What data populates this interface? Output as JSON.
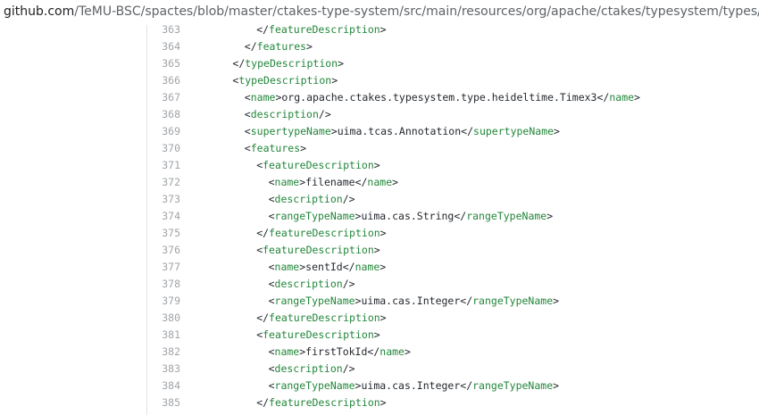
{
  "browser": {
    "url_domain": "github.com",
    "url_path": "/TeMU-BSC/spactes/blob/master/ctakes-type-system/src/main/resources/org/apache/ctakes/typesystem/types/TypeSystem.xml"
  },
  "colors": {
    "tag": "#22863a",
    "text": "#24292e",
    "line_number": "#a0a4a8",
    "gutter_border": "#e1e4e8"
  },
  "lines": [
    {
      "num": "363",
      "indent": 3,
      "parts": [
        {
          "t": "</",
          "c": "punct"
        },
        {
          "t": "featureDescription",
          "c": "tag"
        },
        {
          "t": ">",
          "c": "punct"
        }
      ]
    },
    {
      "num": "364",
      "indent": 2,
      "parts": [
        {
          "t": "</",
          "c": "punct"
        },
        {
          "t": "features",
          "c": "tag"
        },
        {
          "t": ">",
          "c": "punct"
        }
      ]
    },
    {
      "num": "365",
      "indent": 1,
      "parts": [
        {
          "t": "</",
          "c": "punct"
        },
        {
          "t": "typeDescription",
          "c": "tag"
        },
        {
          "t": ">",
          "c": "punct"
        }
      ]
    },
    {
      "num": "366",
      "indent": 1,
      "parts": [
        {
          "t": "<",
          "c": "punct"
        },
        {
          "t": "typeDescription",
          "c": "tag"
        },
        {
          "t": ">",
          "c": "punct"
        }
      ]
    },
    {
      "num": "367",
      "indent": 2,
      "parts": [
        {
          "t": "<",
          "c": "punct"
        },
        {
          "t": "name",
          "c": "tag"
        },
        {
          "t": ">",
          "c": "punct"
        },
        {
          "t": "org.apache.ctakes.typesystem.type.heideltime.Timex3",
          "c": "text"
        },
        {
          "t": "</",
          "c": "punct"
        },
        {
          "t": "name",
          "c": "tag"
        },
        {
          "t": ">",
          "c": "punct"
        }
      ]
    },
    {
      "num": "368",
      "indent": 2,
      "parts": [
        {
          "t": "<",
          "c": "punct"
        },
        {
          "t": "description",
          "c": "tag"
        },
        {
          "t": "/>",
          "c": "punct"
        }
      ]
    },
    {
      "num": "369",
      "indent": 2,
      "parts": [
        {
          "t": "<",
          "c": "punct"
        },
        {
          "t": "supertypeName",
          "c": "tag"
        },
        {
          "t": ">",
          "c": "punct"
        },
        {
          "t": "uima.tcas.Annotation",
          "c": "text"
        },
        {
          "t": "</",
          "c": "punct"
        },
        {
          "t": "supertypeName",
          "c": "tag"
        },
        {
          "t": ">",
          "c": "punct"
        }
      ]
    },
    {
      "num": "370",
      "indent": 2,
      "parts": [
        {
          "t": "<",
          "c": "punct"
        },
        {
          "t": "features",
          "c": "tag"
        },
        {
          "t": ">",
          "c": "punct"
        }
      ]
    },
    {
      "num": "371",
      "indent": 3,
      "parts": [
        {
          "t": "<",
          "c": "punct"
        },
        {
          "t": "featureDescription",
          "c": "tag"
        },
        {
          "t": ">",
          "c": "punct"
        }
      ]
    },
    {
      "num": "372",
      "indent": 4,
      "parts": [
        {
          "t": "<",
          "c": "punct"
        },
        {
          "t": "name",
          "c": "tag"
        },
        {
          "t": ">",
          "c": "punct"
        },
        {
          "t": "filename",
          "c": "text"
        },
        {
          "t": "</",
          "c": "punct"
        },
        {
          "t": "name",
          "c": "tag"
        },
        {
          "t": ">",
          "c": "punct"
        }
      ]
    },
    {
      "num": "373",
      "indent": 4,
      "parts": [
        {
          "t": "<",
          "c": "punct"
        },
        {
          "t": "description",
          "c": "tag"
        },
        {
          "t": "/>",
          "c": "punct"
        }
      ]
    },
    {
      "num": "374",
      "indent": 4,
      "parts": [
        {
          "t": "<",
          "c": "punct"
        },
        {
          "t": "rangeTypeName",
          "c": "tag"
        },
        {
          "t": ">",
          "c": "punct"
        },
        {
          "t": "uima.cas.String",
          "c": "text"
        },
        {
          "t": "</",
          "c": "punct"
        },
        {
          "t": "rangeTypeName",
          "c": "tag"
        },
        {
          "t": ">",
          "c": "punct"
        }
      ]
    },
    {
      "num": "375",
      "indent": 3,
      "parts": [
        {
          "t": "</",
          "c": "punct"
        },
        {
          "t": "featureDescription",
          "c": "tag"
        },
        {
          "t": ">",
          "c": "punct"
        }
      ]
    },
    {
      "num": "376",
      "indent": 3,
      "parts": [
        {
          "t": "<",
          "c": "punct"
        },
        {
          "t": "featureDescription",
          "c": "tag"
        },
        {
          "t": ">",
          "c": "punct"
        }
      ]
    },
    {
      "num": "377",
      "indent": 4,
      "parts": [
        {
          "t": "<",
          "c": "punct"
        },
        {
          "t": "name",
          "c": "tag"
        },
        {
          "t": ">",
          "c": "punct"
        },
        {
          "t": "sentId",
          "c": "text"
        },
        {
          "t": "</",
          "c": "punct"
        },
        {
          "t": "name",
          "c": "tag"
        },
        {
          "t": ">",
          "c": "punct"
        }
      ]
    },
    {
      "num": "378",
      "indent": 4,
      "parts": [
        {
          "t": "<",
          "c": "punct"
        },
        {
          "t": "description",
          "c": "tag"
        },
        {
          "t": "/>",
          "c": "punct"
        }
      ]
    },
    {
      "num": "379",
      "indent": 4,
      "parts": [
        {
          "t": "<",
          "c": "punct"
        },
        {
          "t": "rangeTypeName",
          "c": "tag"
        },
        {
          "t": ">",
          "c": "punct"
        },
        {
          "t": "uima.cas.Integer",
          "c": "text"
        },
        {
          "t": "</",
          "c": "punct"
        },
        {
          "t": "rangeTypeName",
          "c": "tag"
        },
        {
          "t": ">",
          "c": "punct"
        }
      ]
    },
    {
      "num": "380",
      "indent": 3,
      "parts": [
        {
          "t": "</",
          "c": "punct"
        },
        {
          "t": "featureDescription",
          "c": "tag"
        },
        {
          "t": ">",
          "c": "punct"
        }
      ]
    },
    {
      "num": "381",
      "indent": 3,
      "parts": [
        {
          "t": "<",
          "c": "punct"
        },
        {
          "t": "featureDescription",
          "c": "tag"
        },
        {
          "t": ">",
          "c": "punct"
        }
      ]
    },
    {
      "num": "382",
      "indent": 4,
      "parts": [
        {
          "t": "<",
          "c": "punct"
        },
        {
          "t": "name",
          "c": "tag"
        },
        {
          "t": ">",
          "c": "punct"
        },
        {
          "t": "firstTokId",
          "c": "text"
        },
        {
          "t": "</",
          "c": "punct"
        },
        {
          "t": "name",
          "c": "tag"
        },
        {
          "t": ">",
          "c": "punct"
        }
      ]
    },
    {
      "num": "383",
      "indent": 4,
      "parts": [
        {
          "t": "<",
          "c": "punct"
        },
        {
          "t": "description",
          "c": "tag"
        },
        {
          "t": "/>",
          "c": "punct"
        }
      ]
    },
    {
      "num": "384",
      "indent": 4,
      "parts": [
        {
          "t": "<",
          "c": "punct"
        },
        {
          "t": "rangeTypeName",
          "c": "tag"
        },
        {
          "t": ">",
          "c": "punct"
        },
        {
          "t": "uima.cas.Integer",
          "c": "text"
        },
        {
          "t": "</",
          "c": "punct"
        },
        {
          "t": "rangeTypeName",
          "c": "tag"
        },
        {
          "t": ">",
          "c": "punct"
        }
      ]
    },
    {
      "num": "385",
      "indent": 3,
      "parts": [
        {
          "t": "</",
          "c": "punct"
        },
        {
          "t": "featureDescription",
          "c": "tag"
        },
        {
          "t": ">",
          "c": "punct"
        }
      ]
    }
  ]
}
